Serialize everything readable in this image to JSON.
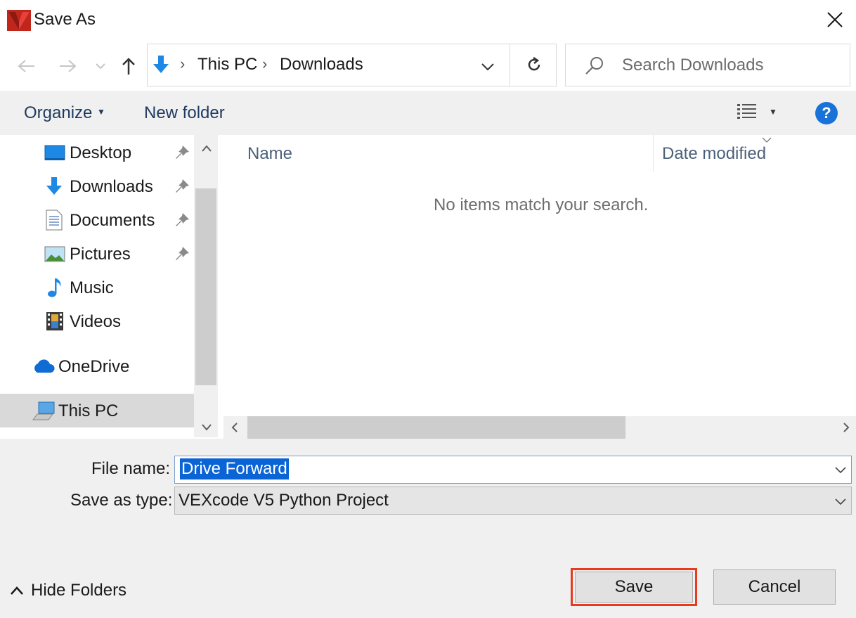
{
  "window": {
    "title": "Save As",
    "close_icon": "close-icon"
  },
  "nav": {
    "back_icon": "arrow-left-icon",
    "forward_icon": "arrow-right-icon",
    "recent_icon": "chevron-down-icon",
    "up_icon": "arrow-up-icon",
    "breadcrumb": [
      "This PC",
      "Downloads"
    ],
    "refresh_icon": "refresh-icon",
    "search_placeholder": "Search Downloads"
  },
  "toolbar": {
    "organize": "Organize",
    "new_folder": "New folder",
    "help": "?"
  },
  "sidebar": {
    "items": [
      {
        "label": "Desktop",
        "icon": "desktop-icon",
        "pinned": true
      },
      {
        "label": "Downloads",
        "icon": "downloads-icon",
        "pinned": true
      },
      {
        "label": "Documents",
        "icon": "documents-icon",
        "pinned": true
      },
      {
        "label": "Pictures",
        "icon": "pictures-icon",
        "pinned": true
      },
      {
        "label": "Music",
        "icon": "music-icon",
        "pinned": false
      },
      {
        "label": "Videos",
        "icon": "videos-icon",
        "pinned": false
      },
      {
        "label": "OneDrive",
        "icon": "onedrive-icon",
        "pinned": false
      },
      {
        "label": "This PC",
        "icon": "this-pc-icon",
        "pinned": false,
        "selected": true
      }
    ]
  },
  "content": {
    "columns": [
      "Name",
      "Date modified"
    ],
    "empty_message": "No items match your search."
  },
  "form": {
    "file_name_label": "File name:",
    "file_name_value": "Drive Forward",
    "save_as_type_label": "Save as type:",
    "save_as_type_value": "VEXcode V5 Python Project"
  },
  "footer": {
    "hide_folders": "Hide Folders",
    "save": "Save",
    "cancel": "Cancel"
  },
  "colors": {
    "accent": "#0a64d6",
    "highlight_border": "#e83a1f",
    "help_blue": "#1872d8"
  }
}
